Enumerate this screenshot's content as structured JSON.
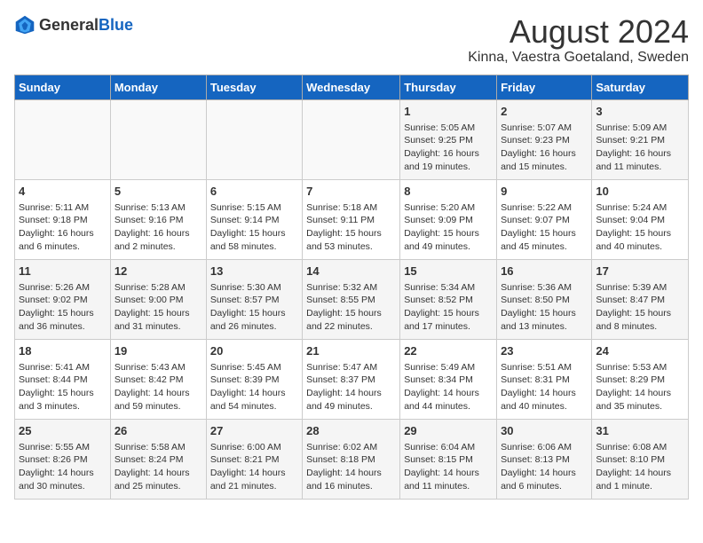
{
  "header": {
    "logo_general": "General",
    "logo_blue": "Blue",
    "title": "August 2024",
    "subtitle": "Kinna, Vaestra Goetaland, Sweden"
  },
  "days_of_week": [
    "Sunday",
    "Monday",
    "Tuesday",
    "Wednesday",
    "Thursday",
    "Friday",
    "Saturday"
  ],
  "weeks": [
    [
      {
        "day": "",
        "content": ""
      },
      {
        "day": "",
        "content": ""
      },
      {
        "day": "",
        "content": ""
      },
      {
        "day": "",
        "content": ""
      },
      {
        "day": "1",
        "content": "Sunrise: 5:05 AM\nSunset: 9:25 PM\nDaylight: 16 hours\nand 19 minutes."
      },
      {
        "day": "2",
        "content": "Sunrise: 5:07 AM\nSunset: 9:23 PM\nDaylight: 16 hours\nand 15 minutes."
      },
      {
        "day": "3",
        "content": "Sunrise: 5:09 AM\nSunset: 9:21 PM\nDaylight: 16 hours\nand 11 minutes."
      }
    ],
    [
      {
        "day": "4",
        "content": "Sunrise: 5:11 AM\nSunset: 9:18 PM\nDaylight: 16 hours\nand 6 minutes."
      },
      {
        "day": "5",
        "content": "Sunrise: 5:13 AM\nSunset: 9:16 PM\nDaylight: 16 hours\nand 2 minutes."
      },
      {
        "day": "6",
        "content": "Sunrise: 5:15 AM\nSunset: 9:14 PM\nDaylight: 15 hours\nand 58 minutes."
      },
      {
        "day": "7",
        "content": "Sunrise: 5:18 AM\nSunset: 9:11 PM\nDaylight: 15 hours\nand 53 minutes."
      },
      {
        "day": "8",
        "content": "Sunrise: 5:20 AM\nSunset: 9:09 PM\nDaylight: 15 hours\nand 49 minutes."
      },
      {
        "day": "9",
        "content": "Sunrise: 5:22 AM\nSunset: 9:07 PM\nDaylight: 15 hours\nand 45 minutes."
      },
      {
        "day": "10",
        "content": "Sunrise: 5:24 AM\nSunset: 9:04 PM\nDaylight: 15 hours\nand 40 minutes."
      }
    ],
    [
      {
        "day": "11",
        "content": "Sunrise: 5:26 AM\nSunset: 9:02 PM\nDaylight: 15 hours\nand 36 minutes."
      },
      {
        "day": "12",
        "content": "Sunrise: 5:28 AM\nSunset: 9:00 PM\nDaylight: 15 hours\nand 31 minutes."
      },
      {
        "day": "13",
        "content": "Sunrise: 5:30 AM\nSunset: 8:57 PM\nDaylight: 15 hours\nand 26 minutes."
      },
      {
        "day": "14",
        "content": "Sunrise: 5:32 AM\nSunset: 8:55 PM\nDaylight: 15 hours\nand 22 minutes."
      },
      {
        "day": "15",
        "content": "Sunrise: 5:34 AM\nSunset: 8:52 PM\nDaylight: 15 hours\nand 17 minutes."
      },
      {
        "day": "16",
        "content": "Sunrise: 5:36 AM\nSunset: 8:50 PM\nDaylight: 15 hours\nand 13 minutes."
      },
      {
        "day": "17",
        "content": "Sunrise: 5:39 AM\nSunset: 8:47 PM\nDaylight: 15 hours\nand 8 minutes."
      }
    ],
    [
      {
        "day": "18",
        "content": "Sunrise: 5:41 AM\nSunset: 8:44 PM\nDaylight: 15 hours\nand 3 minutes."
      },
      {
        "day": "19",
        "content": "Sunrise: 5:43 AM\nSunset: 8:42 PM\nDaylight: 14 hours\nand 59 minutes."
      },
      {
        "day": "20",
        "content": "Sunrise: 5:45 AM\nSunset: 8:39 PM\nDaylight: 14 hours\nand 54 minutes."
      },
      {
        "day": "21",
        "content": "Sunrise: 5:47 AM\nSunset: 8:37 PM\nDaylight: 14 hours\nand 49 minutes."
      },
      {
        "day": "22",
        "content": "Sunrise: 5:49 AM\nSunset: 8:34 PM\nDaylight: 14 hours\nand 44 minutes."
      },
      {
        "day": "23",
        "content": "Sunrise: 5:51 AM\nSunset: 8:31 PM\nDaylight: 14 hours\nand 40 minutes."
      },
      {
        "day": "24",
        "content": "Sunrise: 5:53 AM\nSunset: 8:29 PM\nDaylight: 14 hours\nand 35 minutes."
      }
    ],
    [
      {
        "day": "25",
        "content": "Sunrise: 5:55 AM\nSunset: 8:26 PM\nDaylight: 14 hours\nand 30 minutes."
      },
      {
        "day": "26",
        "content": "Sunrise: 5:58 AM\nSunset: 8:24 PM\nDaylight: 14 hours\nand 25 minutes."
      },
      {
        "day": "27",
        "content": "Sunrise: 6:00 AM\nSunset: 8:21 PM\nDaylight: 14 hours\nand 21 minutes."
      },
      {
        "day": "28",
        "content": "Sunrise: 6:02 AM\nSunset: 8:18 PM\nDaylight: 14 hours\nand 16 minutes."
      },
      {
        "day": "29",
        "content": "Sunrise: 6:04 AM\nSunset: 8:15 PM\nDaylight: 14 hours\nand 11 minutes."
      },
      {
        "day": "30",
        "content": "Sunrise: 6:06 AM\nSunset: 8:13 PM\nDaylight: 14 hours\nand 6 minutes."
      },
      {
        "day": "31",
        "content": "Sunrise: 6:08 AM\nSunset: 8:10 PM\nDaylight: 14 hours\nand 1 minute."
      }
    ]
  ]
}
